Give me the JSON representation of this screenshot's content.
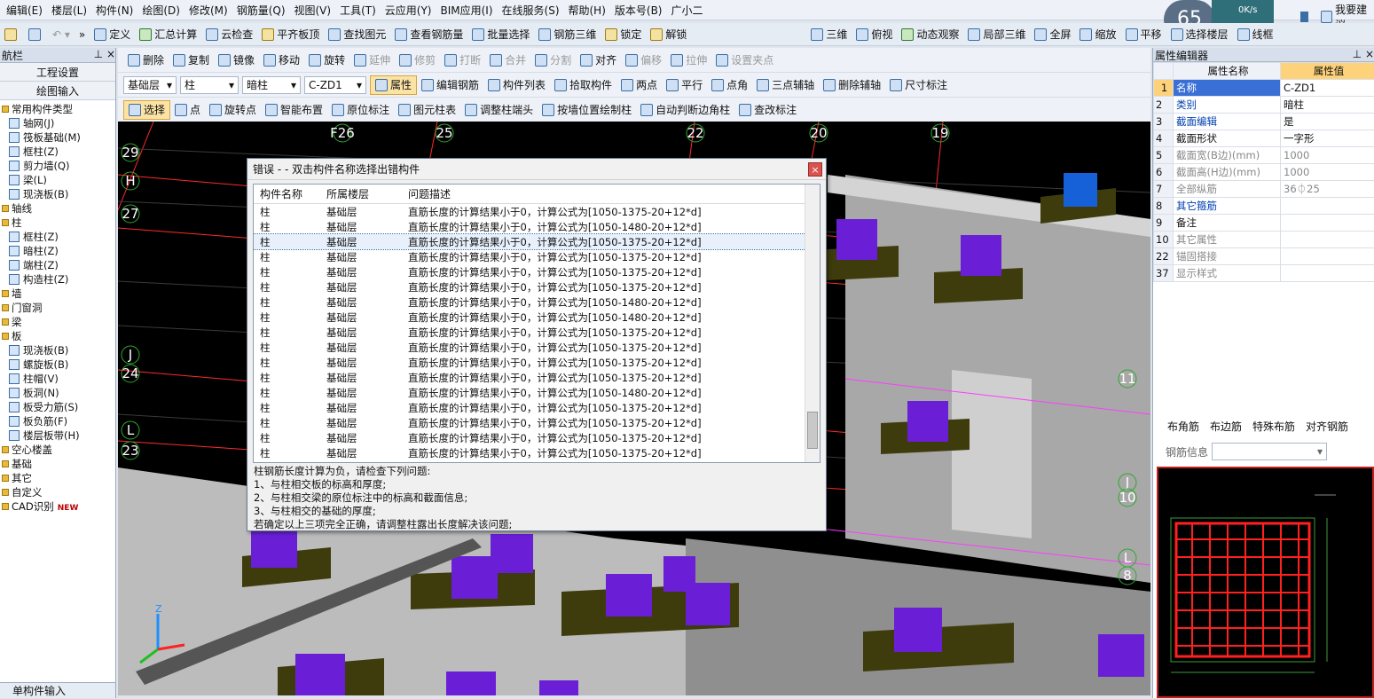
{
  "menu": [
    "编辑(E)",
    "楼层(L)",
    "构件(N)",
    "绘图(D)",
    "修改(M)",
    "钢筋量(Q)",
    "视图(V)",
    "工具(T)",
    "云应用(Y)",
    "BIM应用(I)",
    "在线服务(S)",
    "帮助(H)",
    "版本号(B)",
    "广小二"
  ],
  "toolbar1": [
    "定义",
    "汇总计算",
    "云检查",
    "平齐板顶",
    "查找图元",
    "查看钢筋量",
    "批量选择",
    "钢筋三维",
    "锁定",
    "解锁",
    "三维",
    "俯视",
    "动态观察",
    "局部三维",
    "全屏",
    "缩放",
    "平移",
    "选择楼层",
    "线框"
  ],
  "netmonitor": {
    "percent": "65",
    "up": "0K/s",
    "down": "0.4K/s",
    "btn": "传"
  },
  "topright": "我要建议",
  "nav": {
    "title": "航栏",
    "btn1": "工程设置",
    "btn2": "绘图输入",
    "bottom": "单构件输入",
    "tree": [
      {
        "label": "常用构件类型",
        "lvl": "l1",
        "fold": true
      },
      {
        "label": "轴网(J)",
        "lvl": "l2"
      },
      {
        "label": "筏板基础(M)",
        "lvl": "l2"
      },
      {
        "label": "框柱(Z)",
        "lvl": "l2"
      },
      {
        "label": "剪力墙(Q)",
        "lvl": "l2"
      },
      {
        "label": "梁(L)",
        "lvl": "l2"
      },
      {
        "label": "现浇板(B)",
        "lvl": "l2"
      },
      {
        "label": "轴线",
        "lvl": "l1",
        "fold": true
      },
      {
        "label": "柱",
        "lvl": "l1",
        "fold": true
      },
      {
        "label": "框柱(Z)",
        "lvl": "l2"
      },
      {
        "label": "暗柱(Z)",
        "lvl": "l2"
      },
      {
        "label": "端柱(Z)",
        "lvl": "l2"
      },
      {
        "label": "构造柱(Z)",
        "lvl": "l2"
      },
      {
        "label": "墙",
        "lvl": "l1",
        "fold": true
      },
      {
        "label": "门窗洞",
        "lvl": "l1",
        "fold": true
      },
      {
        "label": "梁",
        "lvl": "l1",
        "fold": true
      },
      {
        "label": "板",
        "lvl": "l1",
        "fold": true
      },
      {
        "label": "现浇板(B)",
        "lvl": "l2"
      },
      {
        "label": "螺旋板(B)",
        "lvl": "l2"
      },
      {
        "label": "柱帽(V)",
        "lvl": "l2"
      },
      {
        "label": "板洞(N)",
        "lvl": "l2"
      },
      {
        "label": "板受力筋(S)",
        "lvl": "l2"
      },
      {
        "label": "板负筋(F)",
        "lvl": "l2"
      },
      {
        "label": "楼层板带(H)",
        "lvl": "l2"
      },
      {
        "label": "空心楼盖",
        "lvl": "l1",
        "fold": true
      },
      {
        "label": "基础",
        "lvl": "l1",
        "fold": true
      },
      {
        "label": "其它",
        "lvl": "l1",
        "fold": true
      },
      {
        "label": "自定义",
        "lvl": "l1",
        "fold": true
      },
      {
        "label": "CAD识别",
        "lvl": "l1",
        "fold": true
      }
    ],
    "new_badge": "NEW"
  },
  "edit_tools": [
    "删除",
    "复制",
    "镜像",
    "移动",
    "旋转",
    "延伸",
    "修剪",
    "打断",
    "合并",
    "分割",
    "对齐",
    "偏移",
    "拉伸",
    "设置夹点"
  ],
  "combos": {
    "floor": "基础层",
    "type": "柱",
    "sub": "暗柱",
    "name": "C-ZD1"
  },
  "row2tools": [
    "属性",
    "编辑钢筋",
    "构件列表",
    "拾取构件",
    "两点",
    "平行",
    "点角",
    "三点辅轴",
    "删除辅轴",
    "尺寸标注"
  ],
  "row3tools": [
    "选择",
    "点",
    "旋转点",
    "智能布置",
    "原位标注",
    "图元柱表",
    "调整柱端头",
    "按墙位置绘制柱",
    "自动判断边角柱",
    "查改标注"
  ],
  "axes_labels": [
    "F26",
    "25",
    "22",
    "20",
    "19",
    "29",
    "H",
    "27",
    "J",
    "24",
    "L",
    "23",
    "11",
    "J",
    "10",
    "L",
    "8"
  ],
  "dialog": {
    "title": "错误 - - 双击构件名称选择出错构件",
    "headers": [
      "构件名称",
      "所属楼层",
      "问题描述"
    ],
    "rows": [
      [
        "柱",
        "基础层",
        "直筋长度的计算结果小于0，计算公式为[1050-1375-20+12*d]"
      ],
      [
        "柱",
        "基础层",
        "直筋长度的计算结果小于0，计算公式为[1050-1480-20+12*d]"
      ],
      [
        "柱",
        "基础层",
        "直筋长度的计算结果小于0，计算公式为[1050-1375-20+12*d]"
      ],
      [
        "柱",
        "基础层",
        "直筋长度的计算结果小于0，计算公式为[1050-1375-20+12*d]"
      ],
      [
        "柱",
        "基础层",
        "直筋长度的计算结果小于0，计算公式为[1050-1375-20+12*d]"
      ],
      [
        "柱",
        "基础层",
        "直筋长度的计算结果小于0，计算公式为[1050-1375-20+12*d]"
      ],
      [
        "柱",
        "基础层",
        "直筋长度的计算结果小于0，计算公式为[1050-1480-20+12*d]"
      ],
      [
        "柱",
        "基础层",
        "直筋长度的计算结果小于0，计算公式为[1050-1480-20+12*d]"
      ],
      [
        "柱",
        "基础层",
        "直筋长度的计算结果小于0，计算公式为[1050-1375-20+12*d]"
      ],
      [
        "柱",
        "基础层",
        "直筋长度的计算结果小于0，计算公式为[1050-1375-20+12*d]"
      ],
      [
        "柱",
        "基础层",
        "直筋长度的计算结果小于0，计算公式为[1050-1375-20+12*d]"
      ],
      [
        "柱",
        "基础层",
        "直筋长度的计算结果小于0，计算公式为[1050-1375-20+12*d]"
      ],
      [
        "柱",
        "基础层",
        "直筋长度的计算结果小于0，计算公式为[1050-1480-20+12*d]"
      ],
      [
        "柱",
        "基础层",
        "直筋长度的计算结果小于0，计算公式为[1050-1375-20+12*d]"
      ],
      [
        "柱",
        "基础层",
        "直筋长度的计算结果小于0，计算公式为[1050-1375-20+12*d]"
      ],
      [
        "柱",
        "基础层",
        "直筋长度的计算结果小于0，计算公式为[1050-1375-20+12*d]"
      ],
      [
        "柱",
        "基础层",
        "直筋长度的计算结果小于0，计算公式为[1050-1375-20+12*d]"
      ]
    ],
    "selected_index": 2,
    "hint": [
      "柱钢筋长度计算为负，请检查下列问题:",
      "1、与柱相交板的标高和厚度;",
      "2、与柱相交梁的原位标注中的标高和截面信息;",
      "3、与柱相交的基础的厚度;",
      "若确定以上三项完全正确，请调整柱露出长度解决该问题;"
    ]
  },
  "props": {
    "title": "属性编辑器",
    "col_name": "属性名称",
    "col_value": "属性值",
    "rows": [
      {
        "n": "1",
        "name": "名称",
        "value": "C-ZD1",
        "style": "selr"
      },
      {
        "n": "2",
        "name": "类别",
        "value": "暗柱",
        "style": "blue"
      },
      {
        "n": "3",
        "name": "截面编辑",
        "value": "是",
        "style": "blue"
      },
      {
        "n": "4",
        "name": "截面形状",
        "value": "一字形",
        "style": ""
      },
      {
        "n": "5",
        "name": "截面宽(B边)(mm)",
        "value": "1000",
        "style": "gray"
      },
      {
        "n": "6",
        "name": "截面高(H边)(mm)",
        "value": "1000",
        "style": "gray"
      },
      {
        "n": "7",
        "name": "全部纵筋",
        "value": "36⏀25",
        "style": "gray"
      },
      {
        "n": "8",
        "name": "其它箍筋",
        "value": "",
        "style": "blue"
      },
      {
        "n": "9",
        "name": "备注",
        "value": "",
        "style": ""
      },
      {
        "n": "10",
        "name": "其它属性",
        "value": "",
        "style": "gray"
      },
      {
        "n": "22",
        "name": "锚固搭接",
        "value": "",
        "style": "gray"
      },
      {
        "n": "37",
        "name": "显示样式",
        "value": "",
        "style": "gray"
      }
    ]
  },
  "rebar_tabs": [
    "布角筋",
    "布边筋",
    "特殊布筋",
    "对齐钢筋"
  ],
  "rebar_info_label": "钢筋信息",
  "colors": {
    "purple": "#6a1fd6",
    "pad": "#3e3c0c",
    "slab": "#a8a8a8",
    "axis": "#ff2a2a",
    "magenta": "#ff3cff"
  }
}
